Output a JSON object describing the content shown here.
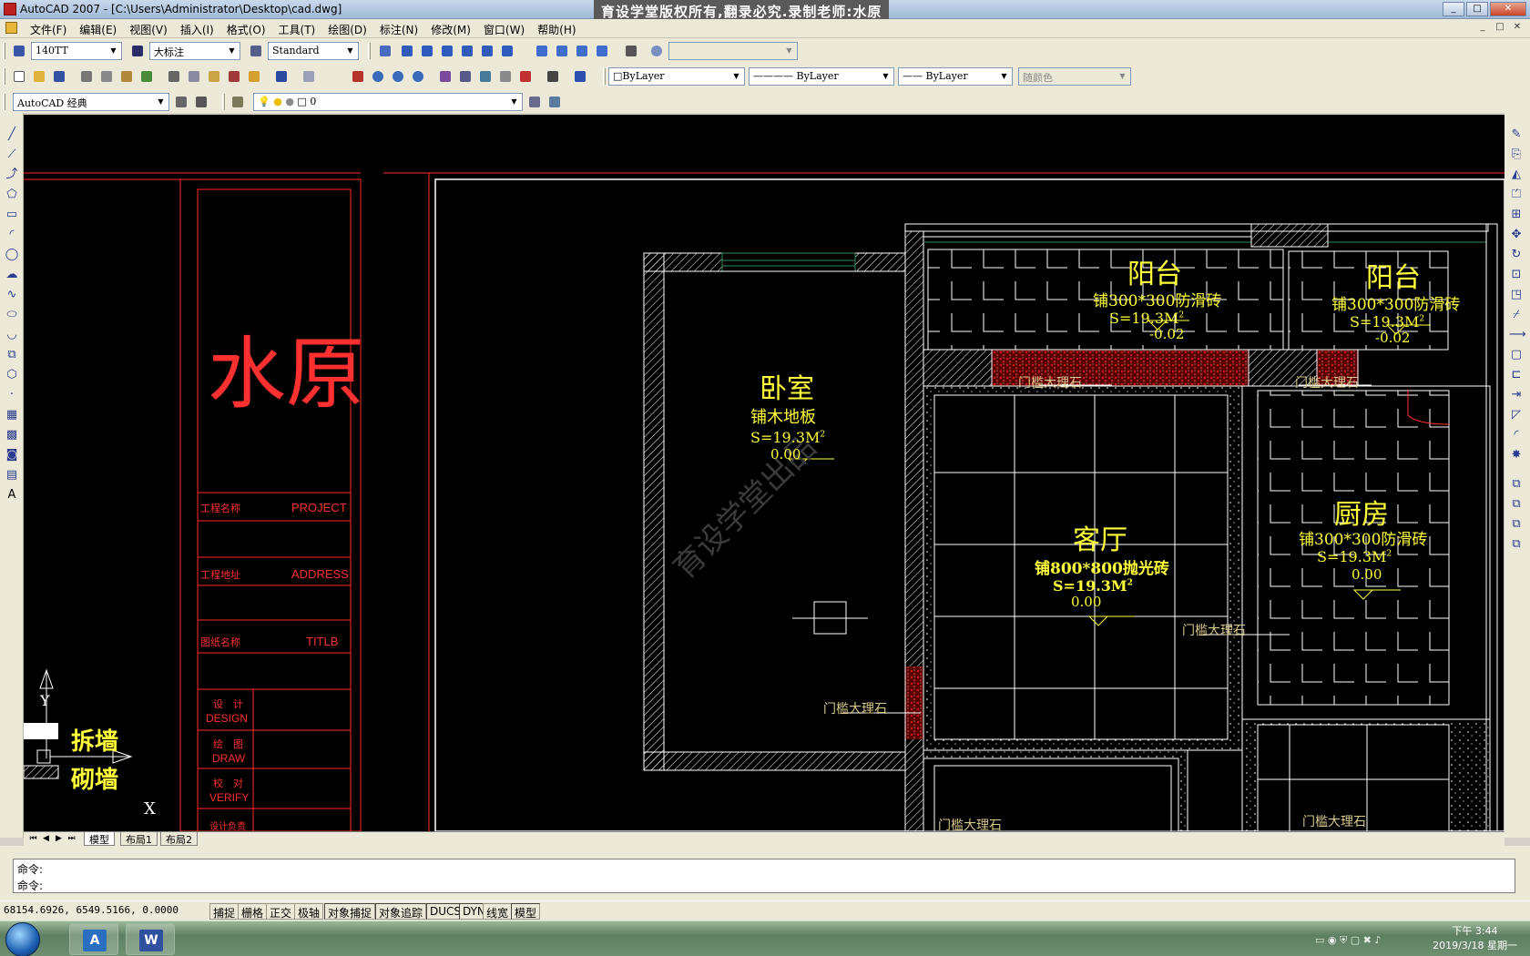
{
  "window": {
    "title": "AutoCAD 2007 - [C:\\Users\\Administrator\\Desktop\\cad.dwg]",
    "banner": "育设学堂版权所有,翻录必究.录制老师:水原",
    "min": "_",
    "max": "□",
    "close": "✕"
  },
  "menu": [
    "文件(F)",
    "编辑(E)",
    "视图(V)",
    "插入(I)",
    "格式(O)",
    "工具(T)",
    "绘图(D)",
    "标注(N)",
    "修改(M)",
    "窗口(W)",
    "帮助(H)"
  ],
  "toolbar1": {
    "text_style": "140TT",
    "dim_style": "大标注",
    "table_style": "Standard"
  },
  "toolbar2": {
    "color": "ByLayer",
    "linetype": "ByLayer",
    "lineweight": "ByLayer",
    "plot_style": "随颜色"
  },
  "toolbar3": {
    "workspace": "AutoCAD 经典",
    "layer": "0"
  },
  "drawing": {
    "title_block": {
      "logo": "水原",
      "rows": [
        {
          "cn": "工程名称",
          "en": "PROJECT"
        },
        {
          "cn": "工程地址",
          "en": "ADDRESS"
        },
        {
          "cn": "图纸名称",
          "en": "TITLB"
        }
      ],
      "signs": [
        {
          "cn": "设　计",
          "en": "DESIGN"
        },
        {
          "cn": "绘　图",
          "en": "DRAW"
        },
        {
          "cn": "校　对",
          "en": "VERIFY"
        },
        {
          "cn": "设计负责",
          "en": ""
        }
      ]
    },
    "legend": {
      "demolish": "拆墙",
      "build": "砌墙"
    },
    "ucs": {
      "x": "X",
      "y": "Y"
    },
    "watermark": "育设学堂出品",
    "rooms": [
      {
        "name": "卧室",
        "material": "铺木地板",
        "area": "S=19.3M",
        "sup": "2",
        "level": "0.00"
      },
      {
        "name": "阳台",
        "material": "铺300*300防滑砖",
        "area": "S=19.3M",
        "sup": "2",
        "level": "-0.02"
      },
      {
        "name": "阳台",
        "material": "铺300*300防滑砖",
        "area": "S=19.3M",
        "sup": "2",
        "level": "-0.02"
      },
      {
        "name": "客厅",
        "material": "铺800*800抛光砖",
        "area": "S=19.3M",
        "sup": "2",
        "level": "0.00"
      },
      {
        "name": "厨房",
        "material": "铺300*300防滑砖",
        "area": "S=19.3M",
        "sup": "2",
        "level": "0.00"
      }
    ],
    "threshold_label": "门槛大理石"
  },
  "tabs": {
    "model": "模型",
    "layout1": "布局1",
    "layout2": "布局2"
  },
  "command": {
    "line1": "命令:",
    "line2": "命令:"
  },
  "status": {
    "coords": "68154.6926, 6549.5166, 0.0000",
    "buttons": [
      "捕捉",
      "栅格",
      "正交",
      "极轴",
      "对象捕捉",
      "对象追踪",
      "DUCS",
      "DYN",
      "线宽",
      "模型"
    ]
  },
  "taskbar": {
    "time": "下午 3:44",
    "date": "2019/3/18 星期一"
  }
}
